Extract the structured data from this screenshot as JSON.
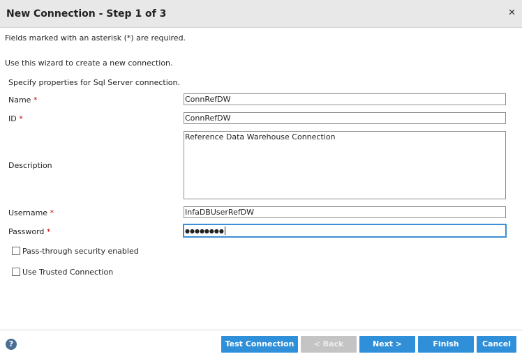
{
  "dialog": {
    "title": "New Connection - Step 1 of 3",
    "close_glyph": "✕"
  },
  "intro": {
    "required_note": "Fields marked with an asterisk (*) are required.",
    "wizard_note": "Use this wizard to create a new connection.",
    "specify": "Specify properties for Sql Server connection."
  },
  "form": {
    "required_mark": "*",
    "name": {
      "label": "Name",
      "value": "ConnRefDW"
    },
    "id": {
      "label": "ID",
      "value": "ConnRefDW"
    },
    "description": {
      "label": "Description",
      "value": "Reference Data Warehouse Connection"
    },
    "username": {
      "label": "Username",
      "value": "InfaDBUserRefDW"
    },
    "password": {
      "label": "Password",
      "value": "●●●●●●●●"
    },
    "passthrough": {
      "label": "Pass-through security enabled",
      "checked": false
    },
    "trusted": {
      "label": "Use Trusted Connection",
      "checked": false
    }
  },
  "footer": {
    "help_glyph": "?",
    "test_connection": "Test Connection",
    "back": "< Back",
    "next": "Next >",
    "finish": "Finish",
    "cancel": "Cancel"
  },
  "colors": {
    "primary_button": "#2f8fd8",
    "disabled_button": "#c4c4c4",
    "focus_border": "#3a8fd6",
    "required": "#cc0000"
  }
}
